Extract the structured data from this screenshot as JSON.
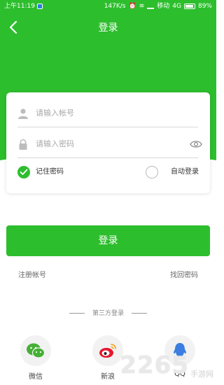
{
  "status_bar": {
    "time": "上午11:19",
    "speed": "147K/s",
    "carrier": "移动",
    "network": "4G",
    "battery": "89%"
  },
  "header": {
    "title": "登录"
  },
  "form": {
    "account_placeholder": "请输入帐号",
    "password_placeholder": "请输入密码",
    "remember_label": "记住密码",
    "auto_login_label": "自动登录"
  },
  "actions": {
    "login_label": "登录",
    "register_label": "注册帐号",
    "forgot_label": "找回密码"
  },
  "third_party": {
    "title": "第三方登录",
    "items": [
      {
        "label": "微信",
        "icon": "wechat-icon"
      },
      {
        "label": "新浪",
        "icon": "weibo-icon"
      },
      {
        "label": "QQ",
        "icon": "qq-icon"
      }
    ]
  },
  "watermark": {
    "number": "2265",
    "text": "手游网"
  },
  "colors": {
    "brand_green": "#2dbe2d"
  }
}
